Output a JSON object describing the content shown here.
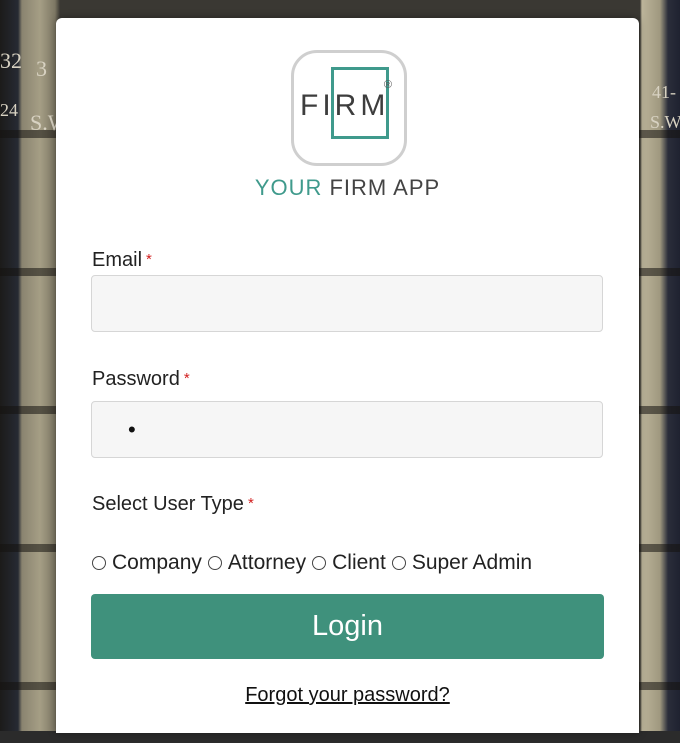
{
  "brand": {
    "logo_text": "FIRM",
    "logo_mark": "®",
    "your": "YOUR",
    "firm_app": " FIRM APP"
  },
  "form": {
    "email_label": "Email",
    "password_label": "Password",
    "password_value": "•",
    "user_type_label": "Select User Type",
    "required_mark": "*",
    "user_types": [
      "Company",
      "Attorney",
      "Client",
      "Super Admin"
    ],
    "login_label": "Login",
    "forgot_label": "Forgot your password?"
  },
  "background": {
    "spine_left_top": "32",
    "spine_left_mid": "24",
    "spine_left_sw": "S.W",
    "spine_right_top": "41-",
    "spine_right_sw": "S.W"
  },
  "colors": {
    "accent": "#3f9a8c",
    "button": "#3f917c",
    "required": "#d21f1f"
  }
}
